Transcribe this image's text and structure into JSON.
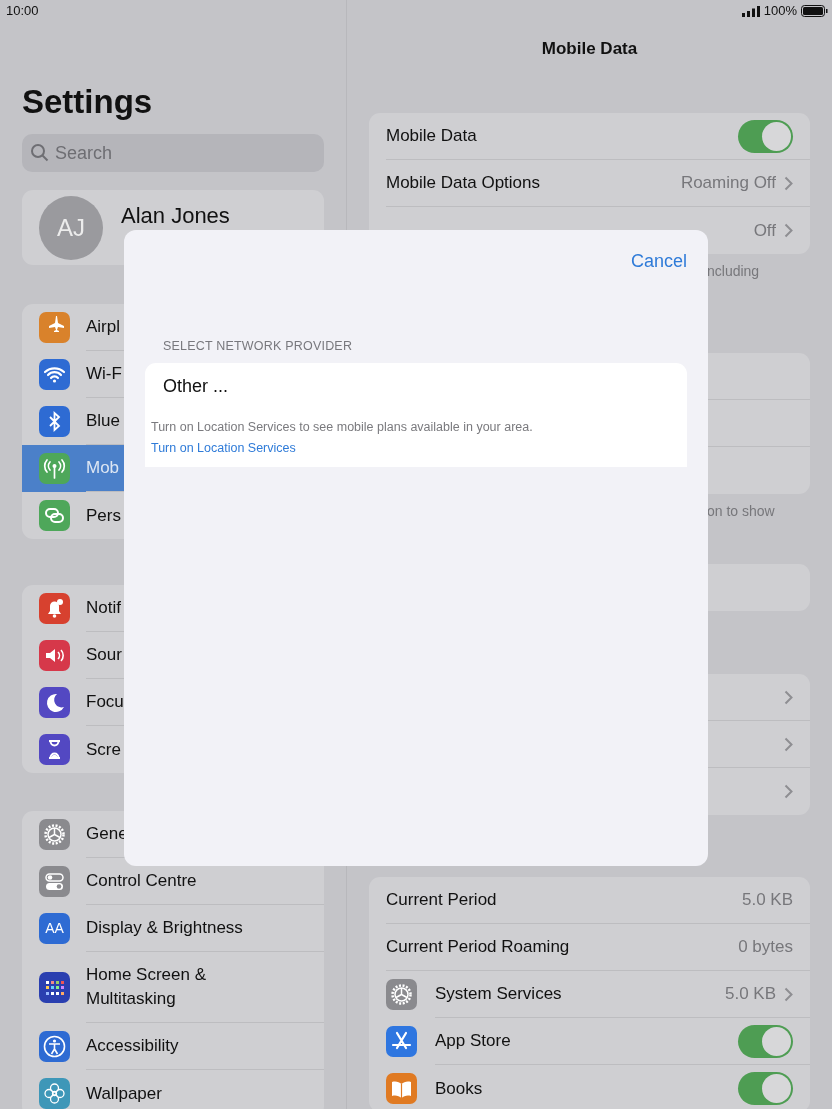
{
  "status_bar": {
    "time": "10:00",
    "battery_text": "100%"
  },
  "sidebar": {
    "title": "Settings",
    "search": {
      "placeholder": "Search"
    },
    "profile": {
      "initials": "AJ",
      "name": "Alan Jones"
    },
    "groups": [
      {
        "items": [
          {
            "label": "Airpl",
            "selected": false
          },
          {
            "label": "Wi-F",
            "selected": false
          },
          {
            "label": "Blue",
            "selected": false
          },
          {
            "label": "Mob",
            "selected": true
          },
          {
            "label": "Pers",
            "selected": false
          }
        ]
      },
      {
        "items": [
          {
            "label": "Notif",
            "selected": false
          },
          {
            "label": "Sour",
            "selected": false
          },
          {
            "label": "Focu",
            "selected": false
          },
          {
            "label": "Scre",
            "selected": false
          }
        ]
      },
      {
        "items": [
          {
            "label": "Gene",
            "selected": false
          },
          {
            "label": "Control Centre",
            "selected": false
          },
          {
            "label": "Display & Brightness",
            "icon_text": "AA",
            "selected": false
          },
          {
            "label": "Home Screen & Multitasking",
            "selected": false
          },
          {
            "label": "Accessibility",
            "selected": false
          },
          {
            "label": "Wallpaper",
            "selected": false
          }
        ]
      }
    ]
  },
  "detail": {
    "title": "Mobile Data",
    "sections": [
      {
        "rows": [
          {
            "kind": "toggle",
            "label": "Mobile Data",
            "on": true
          },
          {
            "kind": "value",
            "label": "Mobile Data Options",
            "value": "Roaming Off",
            "chevron": true
          },
          {
            "kind": "value",
            "value": "Off",
            "chevron": true
          }
        ],
        "footer": "ncluding"
      },
      {
        "rows": [
          {
            "kind": "empty"
          },
          {
            "kind": "empty"
          },
          {
            "kind": "empty"
          }
        ],
        "footer": "on to show"
      },
      {
        "rows": [
          {
            "kind": "empty"
          }
        ]
      },
      {
        "rows": [
          {
            "kind": "value",
            "chevron": true
          },
          {
            "kind": "value",
            "chevron": true
          },
          {
            "kind": "value",
            "chevron": true
          }
        ]
      },
      {
        "rows": [
          {
            "kind": "value",
            "label": "Current Period",
            "value": "5.0 KB"
          },
          {
            "kind": "value",
            "label": "Current Period Roaming",
            "value": "0 bytes"
          },
          {
            "kind": "value",
            "label": "System Services",
            "value": "5.0 KB",
            "chevron": true
          },
          {
            "kind": "toggle",
            "label": "App Store",
            "on": true
          },
          {
            "kind": "toggle",
            "label": "Books",
            "on": true
          }
        ]
      }
    ]
  },
  "sheet": {
    "cancel": "Cancel",
    "header": "SELECT NETWORK PROVIDER",
    "options": [
      "Other ..."
    ],
    "note": "Turn on Location Services to see mobile plans available in your area.",
    "link": "Turn on Location Services"
  }
}
